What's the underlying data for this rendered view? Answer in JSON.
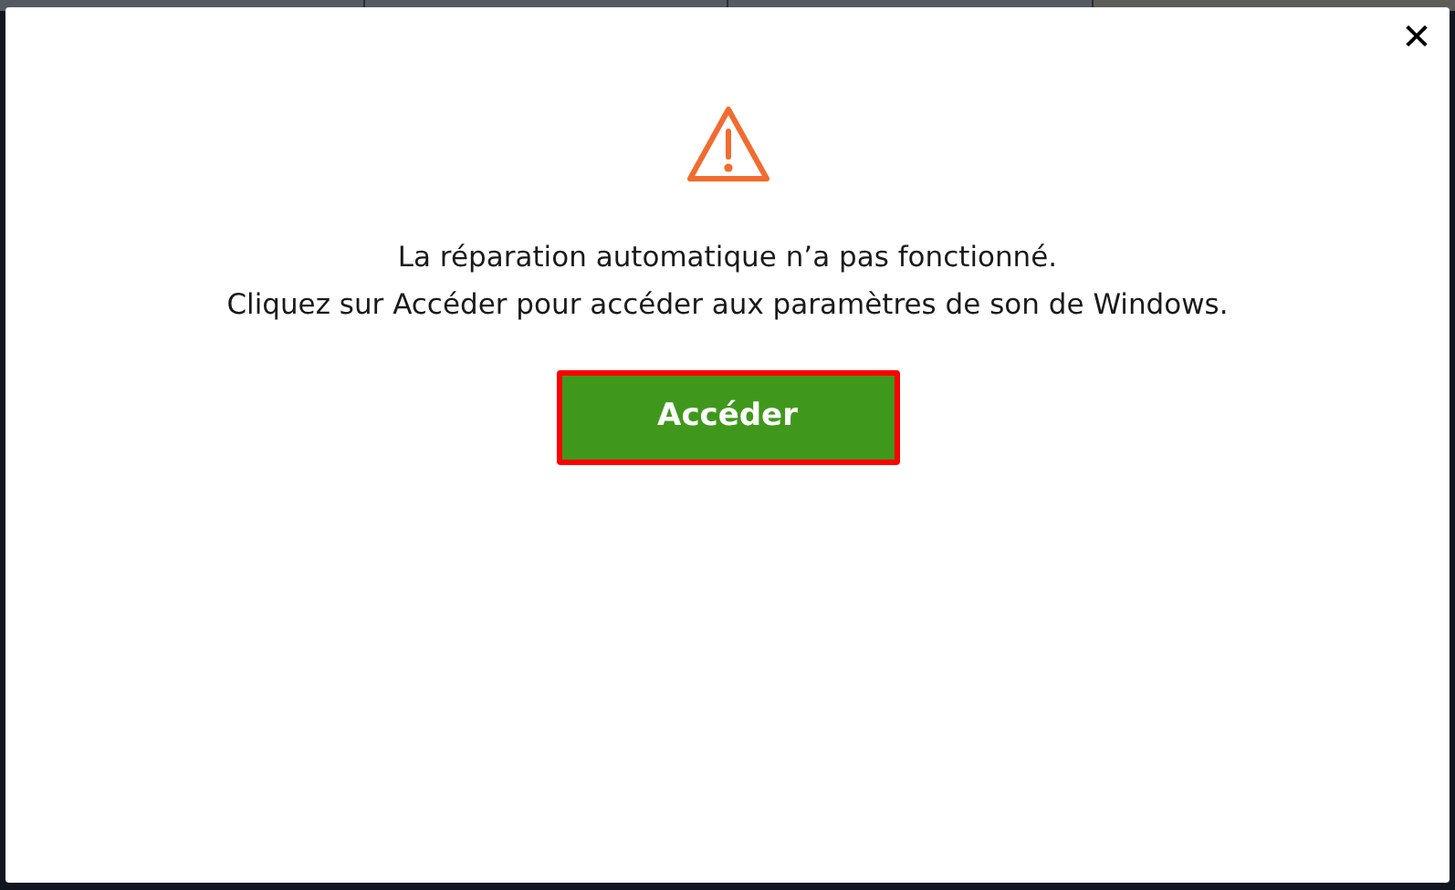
{
  "dialog": {
    "close": "✕",
    "message": [
      "La réparation automatique n’a pas fonctionné.",
      "Cliquez sur Accéder pour accéder aux paramètres de son de Windows."
    ],
    "button": {
      "label": "Accéder",
      "highlighted": true
    }
  }
}
